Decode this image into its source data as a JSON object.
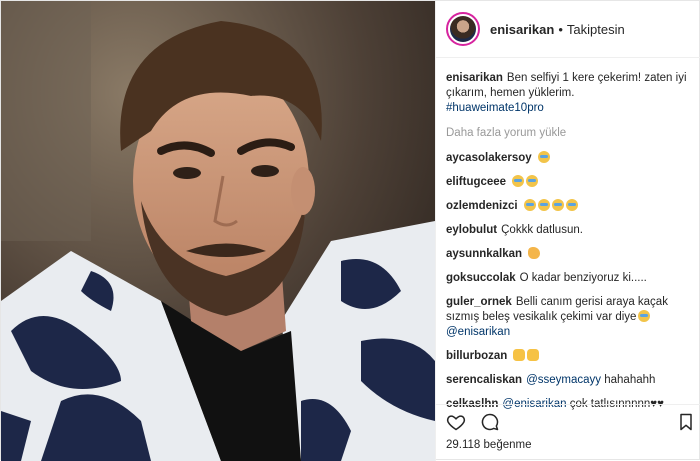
{
  "post": {
    "username": "enisarikan",
    "separator": "•",
    "follow_status": "Takiptesin",
    "caption_user": "enisarikan",
    "caption_text": "Ben selfiyi 1 kere çekerim! zaten iyi çıkarım, hemen yüklerim.",
    "caption_tag": "#huaweimate10pro",
    "load_more": "Daha fazla yorum yükle",
    "comments": [
      {
        "user": "aycasolakersoy",
        "text": "",
        "emoji": [
          "cry"
        ]
      },
      {
        "user": "eliftugceee",
        "text": "",
        "emoji": [
          "cry",
          "cry"
        ]
      },
      {
        "user": "ozlemdenizci",
        "text": "",
        "emoji": [
          "cry",
          "cry",
          "cry",
          "cry"
        ]
      },
      {
        "user": "eylobulut",
        "text": "Çokkk datlusun.",
        "emoji": []
      },
      {
        "user": "aysunnkalkan",
        "text": "",
        "emoji": [
          "flex"
        ]
      },
      {
        "user": "goksuccolak",
        "text": "O kadar benziyoruz ki.....",
        "emoji": []
      },
      {
        "user": "guler_ornek",
        "text": "Belli canım gerisi araya kaçak sızmış beleş vesikalık çekimi var diye",
        "emoji": [
          "cry"
        ],
        "mention": "@enisarikan"
      },
      {
        "user": "billurbozan",
        "text": "",
        "emoji": [
          "hands",
          "hands"
        ]
      },
      {
        "user": "serencaliskan",
        "text": "hahahahh",
        "emoji": [],
        "mention_before": "@sseymacayy"
      },
      {
        "user": "celkaslhn",
        "text": "çok tatlısınnnnn",
        "emoji": [
          "heart",
          "heart"
        ],
        "mention_before": "@enisarikan"
      }
    ],
    "likes_count": "29.118",
    "likes_label": "beğenme"
  },
  "icons": {
    "like": "heart-icon",
    "comment": "comment-icon",
    "save": "bookmark-icon"
  },
  "colors": {
    "link": "#003569",
    "muted": "#999999",
    "text": "#262626"
  }
}
